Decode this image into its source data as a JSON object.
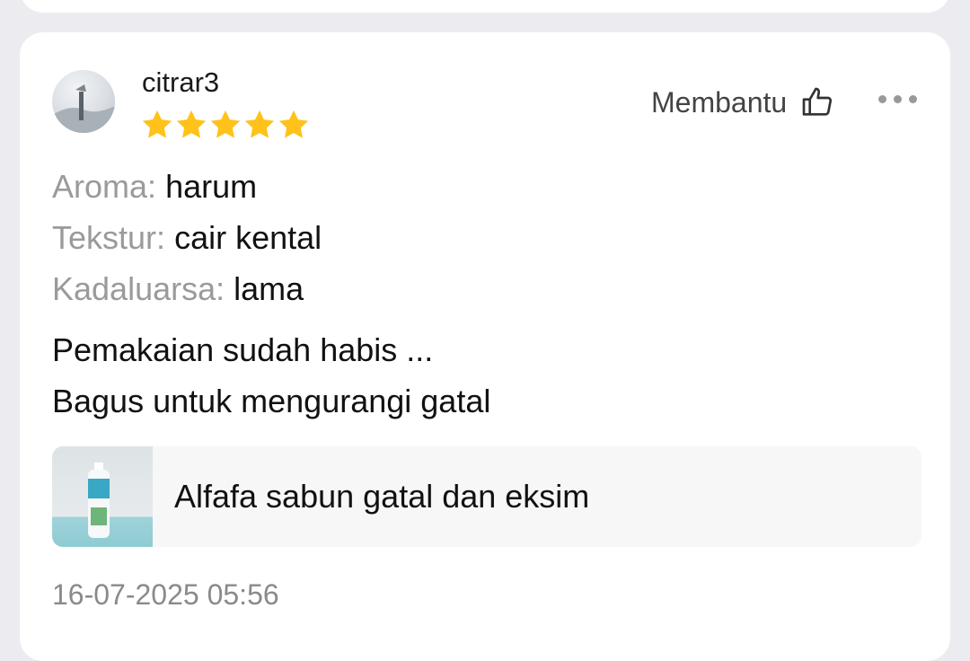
{
  "review": {
    "username": "citrar3",
    "rating": 5,
    "rating_max": 5,
    "helpful_label": "Membantu",
    "attributes": [
      {
        "key": "Aroma:",
        "value": "harum"
      },
      {
        "key": "Tekstur:",
        "value": "cair kental"
      },
      {
        "key": "Kadaluarsa:",
        "value": "lama"
      }
    ],
    "text_lines": [
      "Pemakaian sudah habis ...",
      "Bagus untuk mengurangi gatal"
    ],
    "product": {
      "name": "Alfafa sabun gatal dan eksim"
    },
    "date": "16-07-2025 05:56"
  },
  "icons": {
    "star": "star-icon",
    "helpful": "thumbs-up-icon",
    "more": "more-icon"
  },
  "colors": {
    "star": "#FFC21A",
    "background": "#ECECF0",
    "card": "#FFFFFF",
    "muted_text": "#9A9A9A"
  }
}
